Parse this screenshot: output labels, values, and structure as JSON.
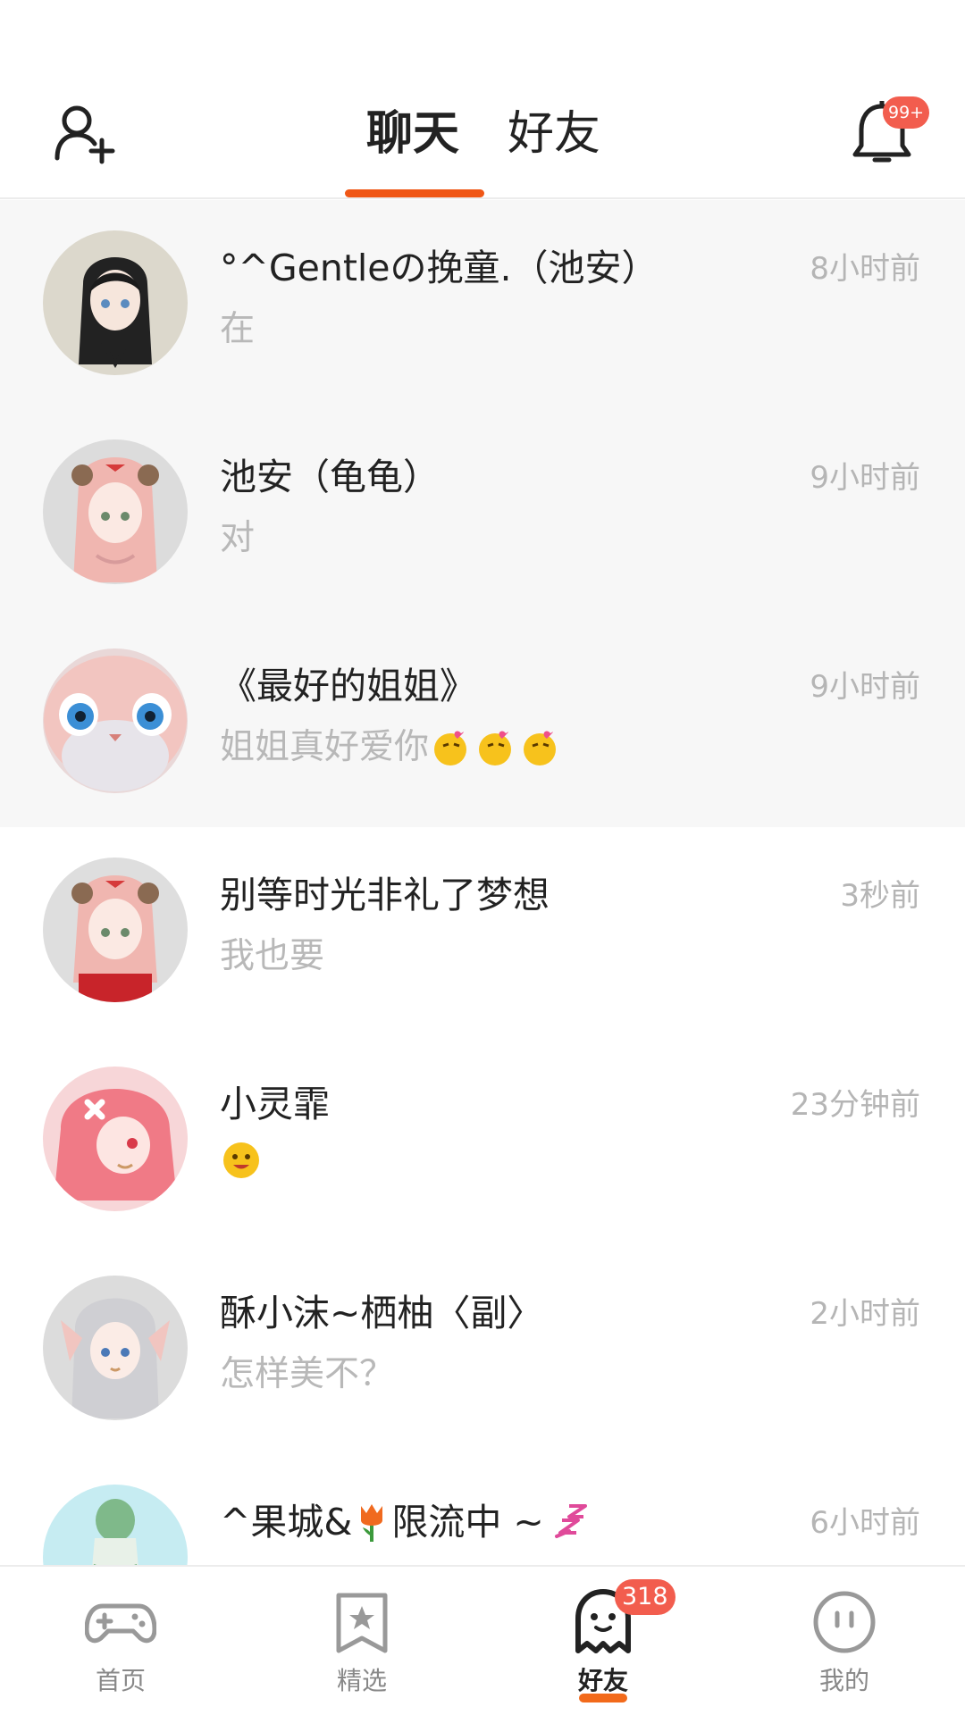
{
  "header": {
    "tabs": [
      {
        "label": "聊天",
        "active": true
      },
      {
        "label": "好友",
        "active": false
      }
    ],
    "notification_badge": "99+",
    "accent_color": "#f05716"
  },
  "conversations": [
    {
      "name": "°^Gentleの挽童.（池安）",
      "message": "在",
      "time": "8小时前",
      "pinned": true
    },
    {
      "name": "池安（龟龟）",
      "message": "对",
      "time": "9小时前",
      "pinned": true
    },
    {
      "name": "《最好的姐姐》",
      "message": "姐姐真好爱你",
      "time": "9小时前",
      "pinned": true,
      "emojis": [
        "kiss-emoji",
        "kiss-emoji",
        "kiss-emoji"
      ]
    },
    {
      "name": "别等时光非礼了梦想",
      "message": "我也要",
      "time": "3秒前",
      "pinned": false
    },
    {
      "name": "小灵霏",
      "message": "",
      "time": "23分钟前",
      "pinned": false,
      "emojis": [
        "smile-emoji"
      ]
    },
    {
      "name": "酥小沫~栖柚〈副〉",
      "message": "怎样美不？",
      "time": "2小时前",
      "pinned": false
    },
    {
      "name": "^果城&",
      "name_suffix": "限流中 ~",
      "time": "6小时前",
      "pinned": false,
      "name_icons": [
        "tulip-icon",
        "zzz-icon"
      ]
    }
  ],
  "tabbar": {
    "items": [
      {
        "label": "首页",
        "icon": "gamepad-icon"
      },
      {
        "label": "精选",
        "icon": "star-bookmark-icon"
      },
      {
        "label": "好友",
        "icon": "ghost-icon",
        "active": true,
        "badge": "318"
      },
      {
        "label": "我的",
        "icon": "face-icon"
      }
    ]
  }
}
